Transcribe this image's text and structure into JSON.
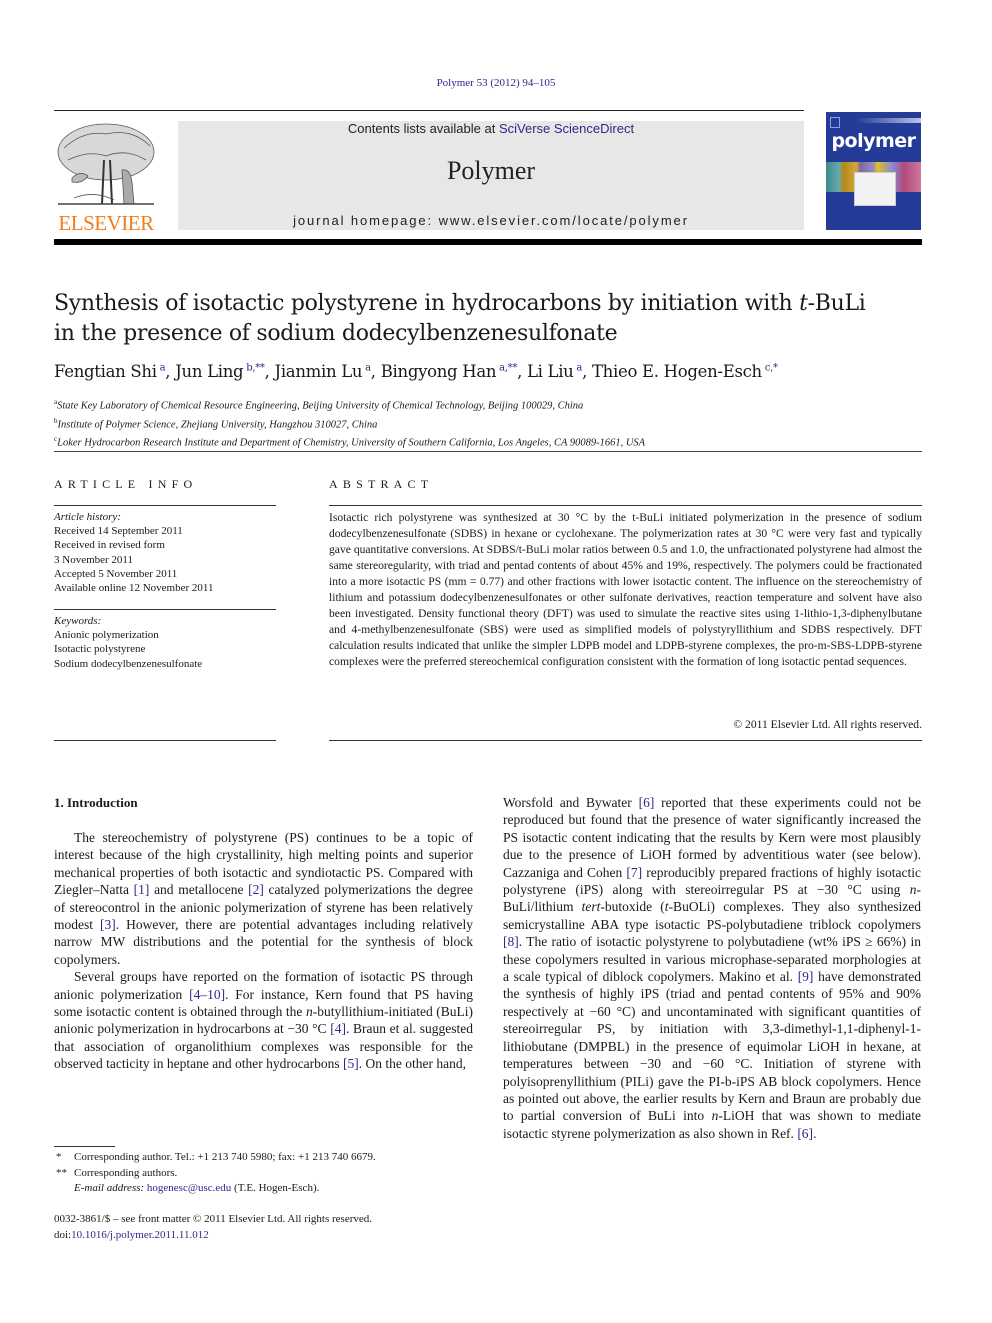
{
  "header": {
    "journal_ref": "Polymer 53 (2012) 94–105",
    "publisher_wordmark": "ELSEVIER",
    "contents_prefix": "Contents lists available at ",
    "contents_link": "SciVerse ScienceDirect",
    "journal_name": "Polymer",
    "homepage_prefix": "journal homepage: ",
    "homepage_url": "www.elsevier.com/locate/polymer",
    "cover_title": "polymer",
    "colors": {
      "link": "#2a2a8a",
      "wordmark": "#f07e1b",
      "masthead_bg": "#e7e7e7",
      "cover_bg": "#243c98"
    }
  },
  "article": {
    "title_line1_prefix": "Synthesis of isotactic polystyrene in hydrocarbons by initiation with ",
    "title_line1_italic": "t",
    "title_line1_suffix": "-BuLi",
    "title_line2": "in the presence of sodium dodecylbenzenesulfonate",
    "authors": [
      {
        "name": "Fengtian Shi",
        "sup": "a"
      },
      {
        "name": "Jun Ling",
        "sup": "b,**"
      },
      {
        "name": "Jianmin Lu",
        "sup": "a"
      },
      {
        "name": "Bingyong Han",
        "sup": "a,**"
      },
      {
        "name": "Li Liu",
        "sup": "a"
      },
      {
        "name": "Thieo E. Hogen-Esch",
        "sup": "c,*"
      }
    ],
    "affiliations": [
      {
        "mark": "a",
        "text": "State Key Laboratory of Chemical Resource Engineering, Beijing University of Chemical Technology, Beijing 100029, China"
      },
      {
        "mark": "b",
        "text": "Institute of Polymer Science, Zhejiang University, Hangzhou 310027, China"
      },
      {
        "mark": "c",
        "text": "Loker Hydrocarbon Research Institute and Department of Chemistry, University of Southern California, Los Angeles, CA 90089-1661, USA"
      }
    ]
  },
  "article_info": {
    "caption": "ARTICLE INFO",
    "history_label": "Article history:",
    "history": [
      "Received 14 September 2011",
      "Received in revised form",
      "3 November 2011",
      "Accepted 5 November 2011",
      "Available online 12 November 2011"
    ],
    "keywords_label": "Keywords:",
    "keywords": [
      "Anionic polymerization",
      "Isotactic polystyrene",
      "Sodium dodecylbenzenesulfonate"
    ]
  },
  "abstract": {
    "caption": "ABSTRACT",
    "text": "Isotactic rich polystyrene was synthesized at 30 °C by the t-BuLi initiated polymerization in the presence of sodium dodecylbenzenesulfonate (SDBS) in hexane or cyclohexane. The polymerization rates at 30 °C were very fast and typically gave quantitative conversions. At SDBS/t-BuLi molar ratios between 0.5 and 1.0, the unfractionated polystyrene had almost the same stereoregularity, with triad and pentad contents of about 45% and 19%, respectively. The polymers could be fractionated into a more isotactic PS (mm = 0.77) and other fractions with lower isotactic content. The influence on the stereochemistry of lithium and potassium dodecylbenzenesulfonates or other sulfonate derivatives, reaction temperature and solvent have also been investigated. Density functional theory (DFT) was used to simulate the reactive sites using 1-lithio-1,3-diphenylbutane and 4-methylbenzenesulfonate (SBS) were used as simplified models of polystyryllithium and SDBS respectively. DFT calculation results indicated that unlike the simpler LDPB model and LDPB-styrene complexes, the pro-m-SBS-LDPB-styrene complexes were the preferred stereochemical configuration consistent with the formation of long isotactic pentad sequences.",
    "copyright": "© 2011 Elsevier Ltd. All rights reserved."
  },
  "body": {
    "section_heading": "1.  Introduction",
    "left_paragraphs": [
      [
        {
          "t": "The stereochemistry of polystyrene (PS) continues to be a topic of interest because of the high crystallinity, high melting points and superior mechanical properties of both isotactic and syndiotactic PS. Compared with Ziegler–Natta "
        },
        {
          "ref": "[1]"
        },
        {
          "t": " and metallocene "
        },
        {
          "ref": "[2]"
        },
        {
          "t": " catalyzed polymerizations the degree of stereocontrol in the anionic polymerization of styrene has been relatively modest "
        },
        {
          "ref": "[3]"
        },
        {
          "t": ". However, there are potential advantages including relatively narrow MW distributions and the potential for the synthesis of block copolymers."
        }
      ],
      [
        {
          "t": "Several groups have reported on the formation of isotactic PS through anionic polymerization "
        },
        {
          "ref": "[4–10]"
        },
        {
          "t": ". For instance, Kern found that PS having some isotactic content is obtained through the "
        },
        {
          "i": "n"
        },
        {
          "t": "-butyllithium-initiated (BuLi) anionic polymerization in hydrocarbons at −30 °C "
        },
        {
          "ref": "[4]"
        },
        {
          "t": ". Braun et al. suggested that association of organolithium complexes was responsible for the observed tacticity in heptane and other hydrocarbons "
        },
        {
          "ref": "[5]"
        },
        {
          "t": ". On the other hand,"
        }
      ]
    ],
    "right_paragraphs": [
      [
        {
          "t": "Worsfold and Bywater "
        },
        {
          "ref": "[6]"
        },
        {
          "t": " reported that these experiments could not be reproduced but found that the presence of water significantly increased the PS isotactic content indicating that the results by Kern were most plausibly due to the presence of LiOH formed by adventitious water (see below). Cazzaniga and Cohen "
        },
        {
          "ref": "[7]"
        },
        {
          "t": " reproducibly prepared fractions of highly isotactic polystyrene (iPS) along with stereoirregular PS at −30 °C using "
        },
        {
          "i": "n"
        },
        {
          "t": "-BuLi/lithium "
        },
        {
          "i": "tert"
        },
        {
          "t": "-butoxide ("
        },
        {
          "i": "t"
        },
        {
          "t": "-BuOLi) complexes. They also synthesized semicrystalline ABA type isotactic PS-polybutadiene triblock copolymers "
        },
        {
          "ref": "[8]"
        },
        {
          "t": ". The ratio of isotactic polystyrene to polybutadiene (wt% iPS ≥ 66%) in these copolymers resulted in various microphase-separated morphologies at a scale typical of diblock copolymers. Makino et al. "
        },
        {
          "ref": "[9]"
        },
        {
          "t": " have demonstrated the synthesis of highly iPS (triad and pentad contents of 95% and 90% respectively at −60 °C) and uncontaminated with significant quantities of stereoirregular PS, by initiation with 3,3-dimethyl-1,1-diphenyl-1-lithiobutane (DMPBL) in the presence of equimolar LiOH in hexane, at temperatures between −30 and −60 °C. Initiation of styrene with polyisoprenyllithium (PILi) gave the PI-b-iPS AB block copolymers. Hence as pointed out above, the earlier results by Kern and Braun are probably due to partial conversion of BuLi into "
        },
        {
          "i": "n"
        },
        {
          "t": "-LiOH that was shown to mediate isotactic styrene polymerization as also shown in Ref. "
        },
        {
          "ref": "[6]"
        },
        {
          "t": "."
        }
      ]
    ]
  },
  "footnotes": {
    "star": {
      "mark": "*",
      "text": "Corresponding author. Tel.: +1 213 740 5980; fax: +1 213 740 6679."
    },
    "double_star": {
      "mark": "**",
      "text": "Corresponding authors."
    },
    "email_label": "E-mail address: ",
    "email": "hogenesc@usc.edu",
    "email_suffix": " (T.E. Hogen-Esch).",
    "front_matter": "0032-3861/$ – see front matter © 2011 Elsevier Ltd. All rights reserved.",
    "doi_prefix": "doi:",
    "doi": "10.1016/j.polymer.2011.11.012"
  }
}
